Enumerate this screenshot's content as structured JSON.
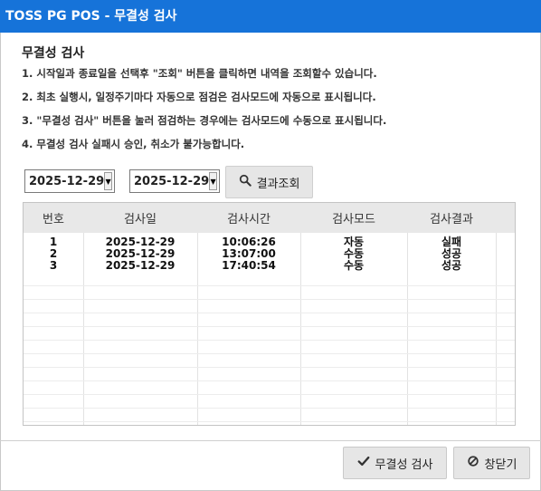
{
  "window": {
    "title": "TOSS PG POS - 무결성 검사"
  },
  "section": {
    "heading": "무결성 검사",
    "notes": [
      "1. 시작일과 종료일을 선택후 \"조회\" 버튼을 클릭하면 내역을 조회할수 있습니다.",
      "2. 최초 실행시, 일정주기마다 자동으로 점검은 검사모드에 자동으로 표시됩니다.",
      "3. \"무결성 검사\" 버튼을 눌러 점검하는 경우에는 검사모드에 수동으로 표시됩니다.",
      "4. 무결성 검사 실패시 승인, 취소가 불가능합니다."
    ]
  },
  "filter": {
    "start_date": "2025-12-29",
    "end_date": "2025-12-29",
    "search_label": "결과조회",
    "search_icon": "magnifier-icon"
  },
  "table": {
    "columns": [
      "번호",
      "검사일",
      "검사시간",
      "검사모드",
      "검사결과"
    ],
    "rows": [
      [
        "1",
        "2025-12-29",
        "10:06:26",
        "자동",
        "실패"
      ],
      [
        "2",
        "2025-12-29",
        "13:07:00",
        "수동",
        "성공"
      ],
      [
        "3",
        "2025-12-29",
        "17:40:54",
        "수동",
        "성공"
      ]
    ]
  },
  "footer": {
    "check_label": "무결성 검사",
    "check_icon": "checkmark-icon",
    "close_label": "창닫기",
    "close_icon": "prohibited-circle-icon"
  },
  "colors": {
    "titlebar": "#1673d9",
    "button_bg": "#e6e6e6",
    "header_bg": "#e8e8e8"
  }
}
